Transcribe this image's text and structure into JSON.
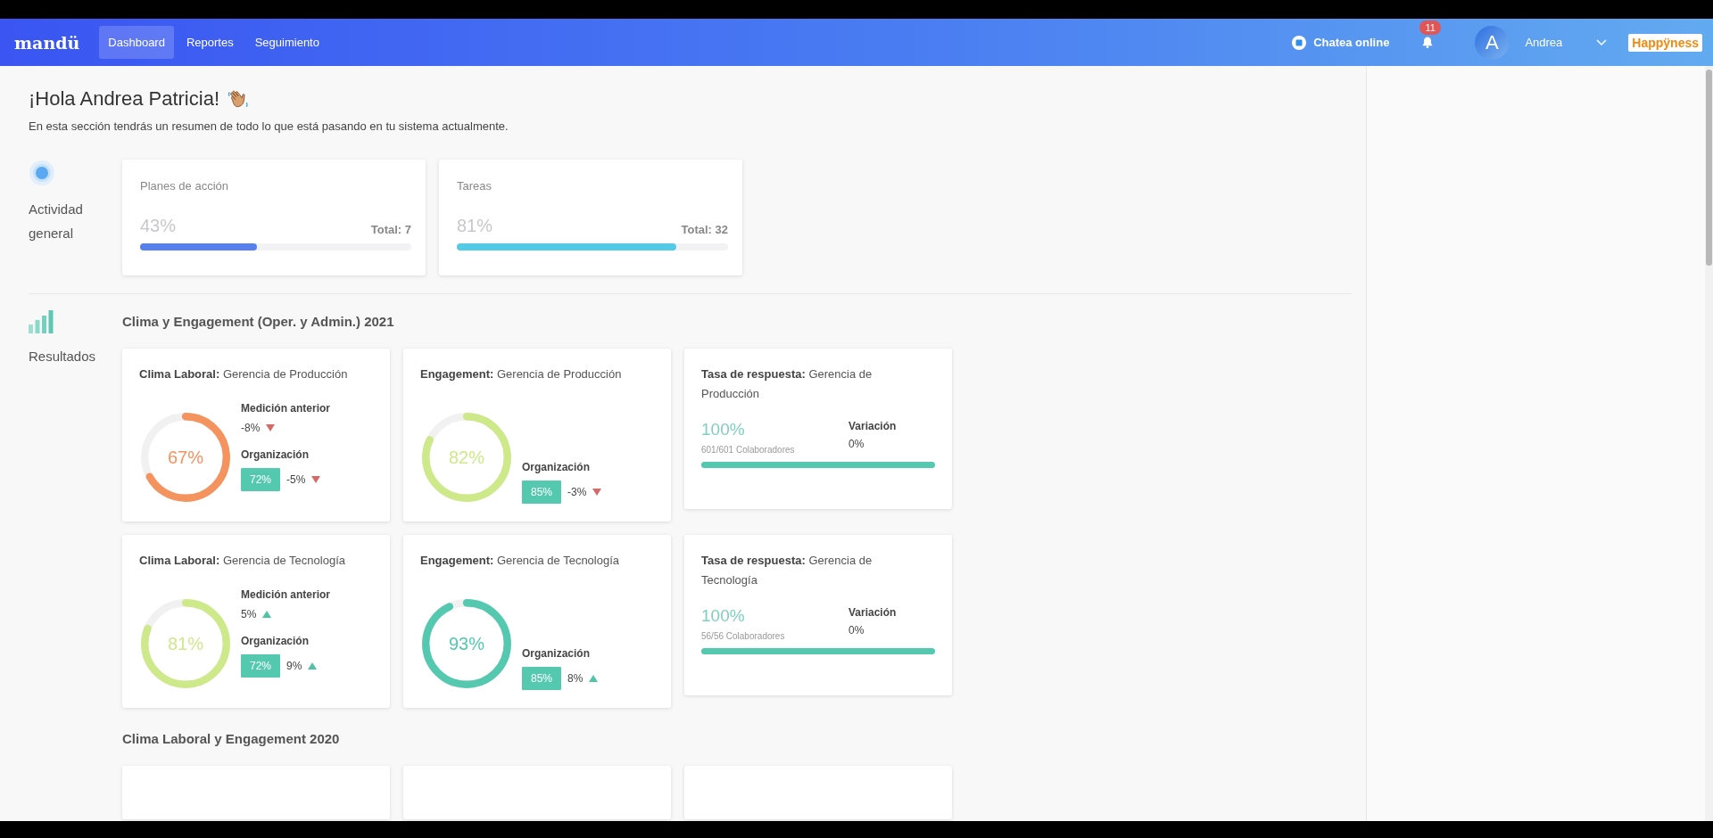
{
  "navbar": {
    "logo": "mandü",
    "items": [
      {
        "label": "Dashboard",
        "selected": true
      },
      {
        "label": "Reportes",
        "selected": false
      },
      {
        "label": "Seguimiento",
        "selected": false
      }
    ],
    "chat": {
      "label": "Chatea online"
    },
    "notifications": {
      "count": "11"
    },
    "user": {
      "initial": "A",
      "name": "Andrea"
    },
    "brand": "Happÿness"
  },
  "greeting": {
    "title": "¡Hola Andrea Patricia!",
    "subtitle": "En esta sección tendrás un resumen de todo lo que está pasando en tu sistema actualmente."
  },
  "activity": {
    "label": "Actividad general",
    "cards": [
      {
        "title": "Planes de acción",
        "percent": "43%",
        "total": "Total: 7",
        "level": 0.43,
        "color": "#5580ee"
      },
      {
        "title": "Tareas",
        "percent": "81%",
        "total": "Total: 32",
        "level": 0.81,
        "color": "#52cbe8"
      }
    ]
  },
  "results": {
    "label": "Resultados",
    "sections": [
      {
        "title": "Clima y Engagement (Oper. y Admin.) 2021",
        "cards": [
          {
            "kind": "clima",
            "metric": "Clima Laboral:",
            "scope": "Gerencia de Producción",
            "value": "67%",
            "level": 0.67,
            "color": "#f5935f",
            "previous": {
              "label": "Medición anterior",
              "value": "-8%",
              "rising": false
            },
            "organization": {
              "label": "Organización",
              "value": "72%",
              "delta": "-5%",
              "rising": false
            }
          },
          {
            "kind": "engagement",
            "metric": "Engagement:",
            "scope": "Gerencia de Producción",
            "value": "82%",
            "level": 0.82,
            "color": "#cde98a",
            "organization": {
              "label": "Organización",
              "value": "85%",
              "delta": "-3%",
              "rising": false
            }
          },
          {
            "kind": "response",
            "metric": "Tasa de respuesta:",
            "scope": "Gerencia de Producción",
            "value": "100%",
            "detail": "601/601 Colaboradores",
            "variation_label": "Variación",
            "variation": "0%",
            "level": 1
          },
          {
            "kind": "clima",
            "metric": "Clima Laboral:",
            "scope": "Gerencia de Tecnología",
            "value": "81%",
            "level": 0.81,
            "color": "#cde98a",
            "previous": {
              "label": "Medición anterior",
              "value": "5%",
              "rising": true
            },
            "organization": {
              "label": "Organización",
              "value": "72%",
              "delta": "9%",
              "rising": true
            }
          },
          {
            "kind": "engagement",
            "metric": "Engagement:",
            "scope": "Gerencia de Tecnología",
            "value": "93%",
            "level": 0.93,
            "color": "#55c8b0",
            "organization": {
              "label": "Organización",
              "value": "85%",
              "delta": "8%",
              "rising": true
            }
          },
          {
            "kind": "response",
            "metric": "Tasa de respuesta:",
            "scope": "Gerencia de Tecnología",
            "value": "100%",
            "detail": "56/56 Colaboradores",
            "variation_label": "Variación",
            "variation": "0%",
            "level": 1
          }
        ]
      },
      {
        "title": "Clima Laboral y Engagement 2020",
        "cards": [
          {
            "kind": "hidden"
          },
          {
            "kind": "hidden"
          },
          {
            "kind": "hidden"
          }
        ]
      }
    ]
  }
}
